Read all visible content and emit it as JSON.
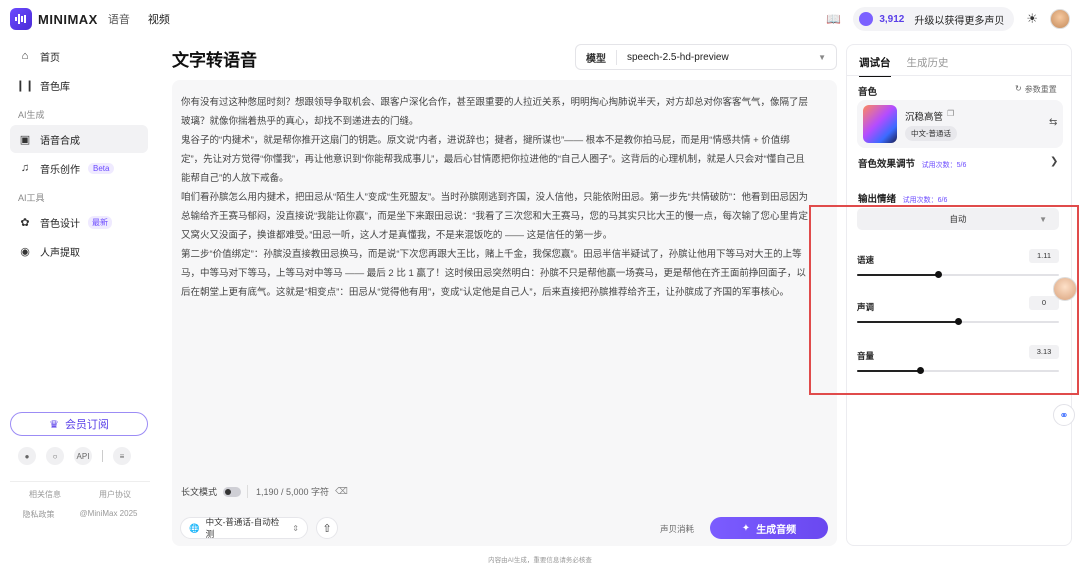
{
  "header": {
    "brand": "MINIMAX",
    "brand_sub": "语音",
    "video": "视频",
    "credits": "3,912",
    "upgrade": "升级以获得更多声贝"
  },
  "sidebar": {
    "items": [
      {
        "label": "首页",
        "icon": "home-icon"
      },
      {
        "label": "音色库",
        "icon": "library-icon"
      }
    ],
    "section_ai_gen": "AI生成",
    "gen_items": [
      {
        "label": "语音合成",
        "icon": "tts-icon",
        "active": true
      },
      {
        "label": "音乐创作",
        "icon": "music-icon",
        "badge": "Beta"
      }
    ],
    "section_ai_tools": "AI工具",
    "tool_items": [
      {
        "label": "音色设计",
        "icon": "voice-design-icon",
        "badge": "最新"
      },
      {
        "label": "人声提取",
        "icon": "vocal-extract-icon"
      }
    ],
    "member_button": "会员订阅",
    "api": "API",
    "footer": {
      "related": "相关信息",
      "agreement": "用户协议",
      "privacy": "隐私政策",
      "copyright": "@MiniMax 2025"
    }
  },
  "main": {
    "title": "文字转语音",
    "model_label": "模型",
    "model_value": "speech-2.5-hd-preview",
    "paragraphs": [
      "你有没有过这种憋屈时刻？想跟领导争取机会、跟客户深化合作，甚至跟重要的人拉近关系，明明掏心掏肺说半天，对方却总对你客客气气，像隔了层玻璃？就像你揣着热乎的真心，却找不到递进去的门缝。",
      "鬼谷子的“内揵术”，就是帮你推开这扇门的钥匙。原文说“内者，进说辞也；揵者，揵所谋也”—— 根本不是教你拍马屁，而是用“情感共情 + 价值绑定”，先让对方觉得“你懂我”，再让他意识到“你能帮我成事儿”，最后心甘情愿把你拉进他的“自己人圈子”。这背后的心理机制，就是人只会对“懂自己且能帮自己”的人放下戒备。",
      "咱们看孙膑怎么用内揵术，把田忌从“陌生人”变成“生死盟友”。当时孙膑刚逃到齐国，没人信他，只能依附田忌。第一步先“共情破防”：他看到田忌因为总输给齐王赛马郁闷，没直接说“我能让你赢”，而是坐下来跟田忌说：“我看了三次您和大王赛马，您的马其实只比大王的慢一点，每次输了您心里肯定又窝火又没面子，换谁都难受。”田忌一听，这人才是真懂我，不是来混饭吃的 —— 这是信任的第一步。",
      "第二步“价值绑定”：孙膑没直接教田忌换马，而是说“下次您再跟大王比，赌上千金，我保您赢”。田忌半信半疑试了，孙膑让他用下等马对大王的上等马，中等马对下等马，上等马对中等马 —— 最后 2 比 1 赢了！这时候田忌突然明白：孙膑不只是帮他赢一场赛马，更是帮他在齐王面前挣回面子，以后在朝堂上更有底气。这就是“相变点”：田忌从“觉得他有用”，变成“认定他是自己人”，后来直接把孙膑推荐给齐王，让孙膑成了齐国的军事核心。"
    ],
    "long_mode": "长文模式",
    "char_count": "1,190 / 5,000 字符",
    "language": "中文-普通话-自动检测",
    "cost": "声贝消耗",
    "generate": "生成音频",
    "disclaimer": "内容由AI生成，重要信息请务必核查"
  },
  "panel": {
    "tab_console": "调试台",
    "tab_history": "生成历史",
    "voice_label": "音色",
    "reset": "参数重置",
    "voice_name": "沉稳高管",
    "voice_tag": "中文-普通话",
    "effect_label": "音色效果调节",
    "effect_trial": "试用次数：5/6",
    "emotion_label": "输出情绪",
    "emotion_trial": "试用次数：6/6",
    "emotion_value": "自动",
    "sliders": [
      {
        "label": "语速",
        "value": "1.11",
        "fraction": 0.4
      },
      {
        "label": "声调",
        "value": "0",
        "fraction": 0.5
      },
      {
        "label": "音量",
        "value": "3.13",
        "fraction": 0.31
      }
    ]
  },
  "colors": {
    "accent": "#6c4bff",
    "highlight": "#e04b4b"
  }
}
